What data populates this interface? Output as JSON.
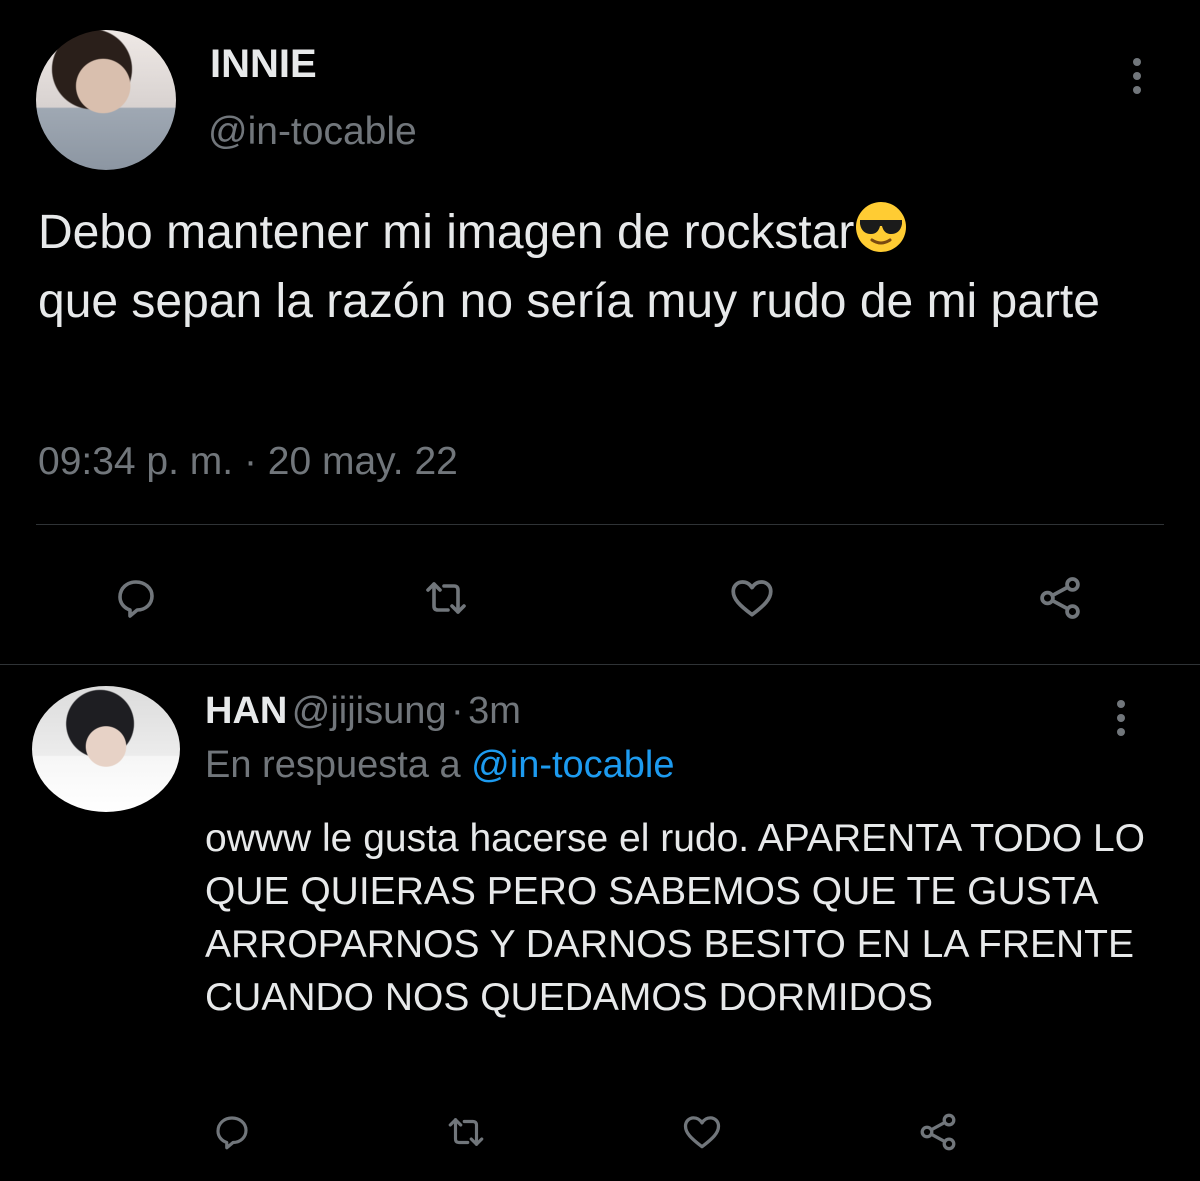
{
  "tweet": {
    "display_name": "INNIE",
    "handle": "@in-tocable",
    "text_line1": "Debo mantener mi imagen de rockstar",
    "text_rest": "que sepan la razón no sería muy rudo de mi parte",
    "timestamp": "09:34 p. m. · 20 may. 22",
    "emoji": "smiling-face-with-sunglasses"
  },
  "reply": {
    "display_name": "HAN",
    "handle": "@jijisung",
    "separator": "·",
    "time": "3m",
    "in_reply_prefix": "En respuesta a",
    "in_reply_mention": "@in-tocable",
    "text": "owww le gusta hacerse el rudo. APARENTA TODO LO QUE QUIERAS PERO SABEMOS QUE TE GUSTA ARROPARNOS Y DARNOS BESITO EN LA FRENTE CUANDO NOS QUEDAMOS DORMIDOS"
  },
  "icons": {
    "reply": "reply-icon",
    "retweet": "retweet-icon",
    "like": "heart-icon",
    "share": "share-icon",
    "more": "more-options-icon"
  },
  "colors": {
    "background": "#000000",
    "text": "#e7e9ea",
    "secondary": "#71767b",
    "link": "#1d9bf0",
    "divider": "#2f3336"
  }
}
